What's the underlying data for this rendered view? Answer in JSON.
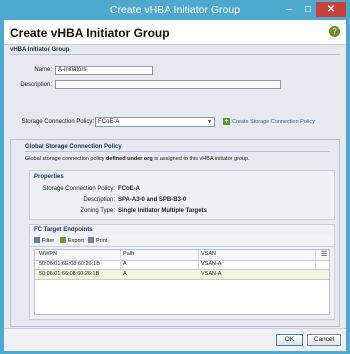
{
  "window": {
    "title": "Create vHBA Initiator Group",
    "minimize_glyph": "–",
    "maximize_glyph": "☐",
    "close_glyph": "✕"
  },
  "dialog": {
    "title": "Create vHBA Initiator Group",
    "help_icon": "help-icon"
  },
  "group": {
    "section_title": "vHBA Initiator Group",
    "name_label": "Name:",
    "name_value": "A-initiators",
    "description_label": "Description:",
    "description_value": ""
  },
  "policy": {
    "label": "Storage Connection Policy:",
    "selected": "FCoE-A",
    "create_link": "Create Storage Connection Policy"
  },
  "global_policy": {
    "section_title": "Global Storage Connection Policy",
    "message_prefix": "Global storage connection policy",
    "message_bold": "defined under org",
    "message_suffix": "is assigned to this vHBA initiator group."
  },
  "properties": {
    "title": "Properties",
    "rows": [
      {
        "label": "Storage Connection Policy:",
        "value": "FCoE-A"
      },
      {
        "label": "Description:",
        "value": "SPA-A3-0 and SPB-B3-0"
      },
      {
        "label": "Zoning Type:",
        "value": "Single Initiator Multiple Targets"
      }
    ]
  },
  "fc_targets": {
    "title": "FC Target Endpoints",
    "toolbar": {
      "filter": "Filter",
      "export": "Export",
      "print": "Print"
    },
    "columns": [
      "WWPN",
      "Path",
      "VSAN"
    ],
    "rows": [
      {
        "wwpn": "50:06:01:6E:08:60:26:1B",
        "path": "A",
        "vsan": "VSAN-A"
      },
      {
        "wwpn": "50:06:01:66:08:60:26:1B",
        "path": "A",
        "vsan": "VSAN-A"
      }
    ]
  },
  "footer": {
    "ok": "OK",
    "cancel": "Cancel"
  },
  "colors": {
    "titlebar": "#4fa9cf",
    "close": "#c8413a",
    "section_title": "#1a2e55",
    "selected_row": "#f6f3dc"
  }
}
